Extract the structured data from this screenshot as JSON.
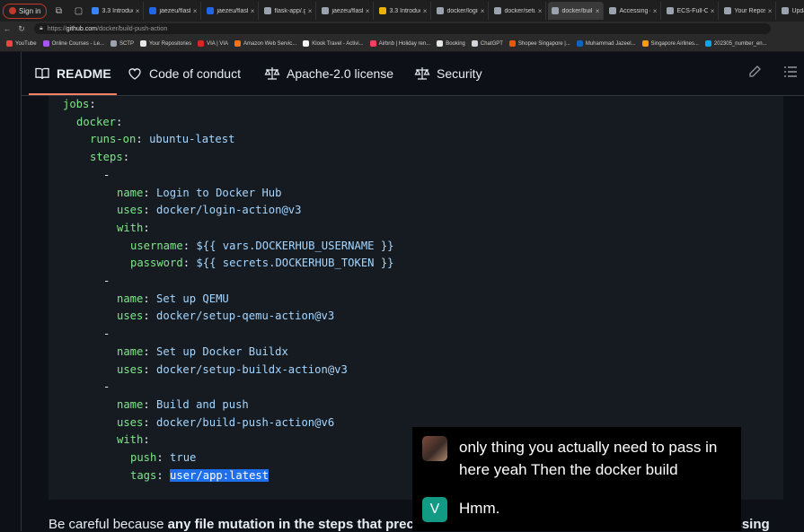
{
  "browser": {
    "sign_in": "Sign in",
    "tabs": [
      {
        "title": "3.3 Introduc",
        "color": "#3b82f6"
      },
      {
        "title": "jaezeu/flask",
        "color": "#2563eb"
      },
      {
        "title": "jaezeu/flask",
        "color": "#2563eb"
      },
      {
        "title": "flask-app/.g",
        "color": "#9ca3af"
      },
      {
        "title": "jaezeu/flask",
        "color": "#9ca3af"
      },
      {
        "title": "3.3 Introduc",
        "color": "#eab308"
      },
      {
        "title": "docker/login",
        "color": "#9ca3af"
      },
      {
        "title": "docker/setu",
        "color": "#9ca3af"
      },
      {
        "title": "docker/buil",
        "color": "#9ca3af",
        "active": true
      },
      {
        "title": "Accessing c",
        "color": "#9ca3af"
      },
      {
        "title": "ECS-Full-CI/",
        "color": "#9ca3af"
      },
      {
        "title": "Your Reposit",
        "color": "#9ca3af"
      },
      {
        "title": "Update mu",
        "color": "#9ca3af"
      }
    ],
    "url_prefix": "https://",
    "url_host": "github.com",
    "url_path": "/docker/build-push-action",
    "bookmarks": [
      {
        "label": "YouTube",
        "color": "#ef4444"
      },
      {
        "label": "Online Courses - Le...",
        "color": "#a855f7"
      },
      {
        "label": "SCTP",
        "color": "#9ca3af"
      },
      {
        "label": "Your Repositories",
        "color": "#e5e7eb"
      },
      {
        "label": "VIA | VIA",
        "color": "#dc2626"
      },
      {
        "label": "Amazon Web Servic...",
        "color": "#f97316"
      },
      {
        "label": "Klook Travel - Activi...",
        "color": "#f3f4f6"
      },
      {
        "label": "Airbnb | Holiday ren...",
        "color": "#f43f5e"
      },
      {
        "label": "Booking",
        "color": "#e5e7eb"
      },
      {
        "label": "ChatGPT",
        "color": "#d1d5db"
      },
      {
        "label": "Shopee Singapore |...",
        "color": "#ea580c"
      },
      {
        "label": "Muhammad Jazeel...",
        "color": "#0a66c2"
      },
      {
        "label": "Singapore Airlines...",
        "color": "#f59e0b"
      },
      {
        "label": "202305_number_en...",
        "color": "#0ea5e9"
      }
    ]
  },
  "readme_nav": {
    "tabs": [
      "README",
      "Code of conduct",
      "Apache-2.0 license",
      "Security"
    ]
  },
  "code_lines": [
    {
      "indent": 1,
      "key": "jobs",
      "val": ""
    },
    {
      "indent": 2,
      "key": "docker",
      "val": ""
    },
    {
      "indent": 3,
      "key": "runs-on",
      "val": "ubuntu-latest"
    },
    {
      "indent": 3,
      "key": "steps",
      "val": ""
    },
    {
      "indent": 4,
      "dash": "-"
    },
    {
      "indent": 5,
      "key": "name",
      "val": "Login to Docker Hub"
    },
    {
      "indent": 5,
      "key": "uses",
      "val": "docker/login-action@v3"
    },
    {
      "indent": 5,
      "key": "with",
      "val": ""
    },
    {
      "indent": 6,
      "key": "username",
      "val": "${{ vars.DOCKERHUB_USERNAME }}"
    },
    {
      "indent": 6,
      "key": "password",
      "val": "${{ secrets.DOCKERHUB_TOKEN }}"
    },
    {
      "indent": 4,
      "dash": "-"
    },
    {
      "indent": 5,
      "key": "name",
      "val": "Set up QEMU"
    },
    {
      "indent": 5,
      "key": "uses",
      "val": "docker/setup-qemu-action@v3"
    },
    {
      "indent": 4,
      "dash": "-"
    },
    {
      "indent": 5,
      "key": "name",
      "val": "Set up Docker Buildx"
    },
    {
      "indent": 5,
      "key": "uses",
      "val": "docker/setup-buildx-action@v3"
    },
    {
      "indent": 4,
      "dash": "-"
    },
    {
      "indent": 5,
      "key": "name",
      "val": "Build and push"
    },
    {
      "indent": 5,
      "key": "uses",
      "val": "docker/build-push-action@v6"
    },
    {
      "indent": 5,
      "key": "with",
      "val": ""
    },
    {
      "indent": 6,
      "key": "push",
      "val": "true"
    },
    {
      "indent": 6,
      "key": "tags",
      "val": "user/app:latest",
      "selected": true
    }
  ],
  "paragraph": {
    "lead": "Be careful because ",
    "bold": "any file mutation in the steps that precede the build step will be ignored, including processing"
  },
  "captions": [
    {
      "avatar": "",
      "text": "only thing you actually need to pass in here yeah Then the docker build"
    },
    {
      "avatar": "V",
      "text": "Hmm."
    }
  ]
}
